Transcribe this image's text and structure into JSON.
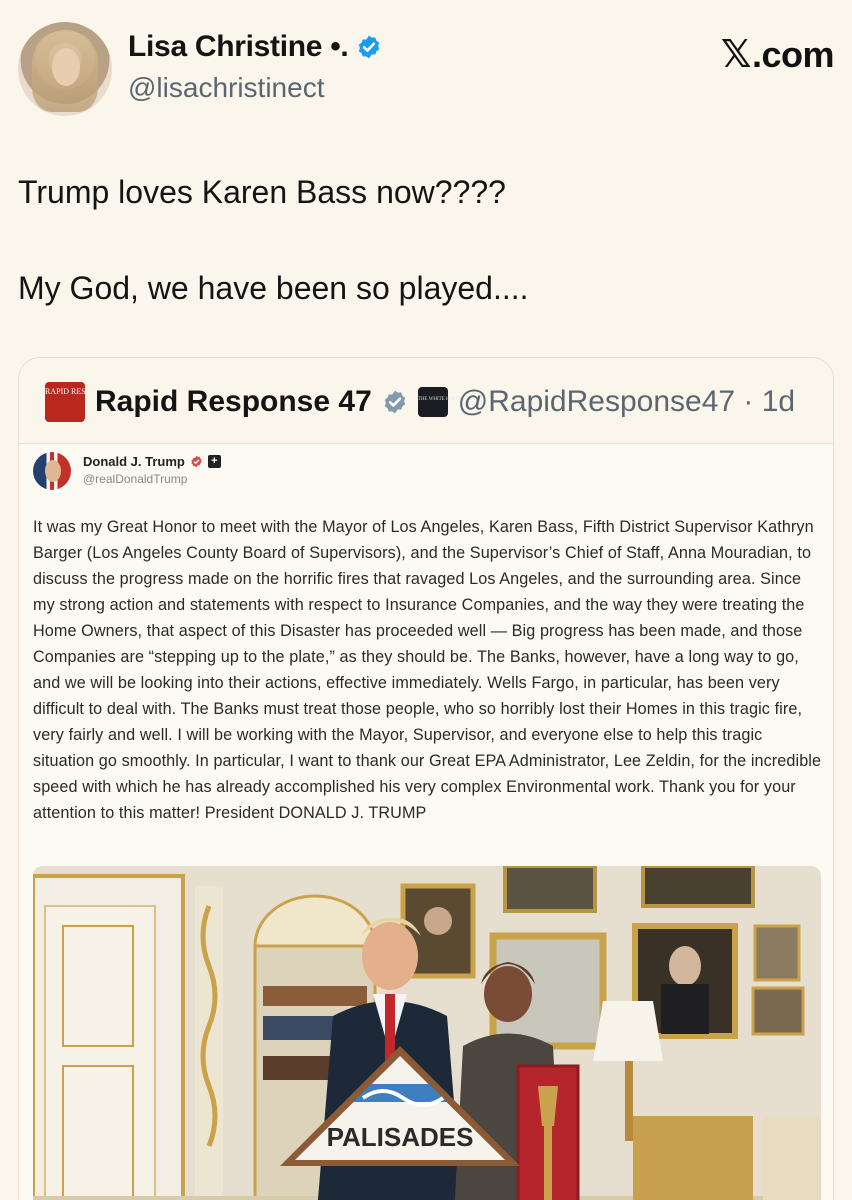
{
  "site_logo": {
    "x_glyph": "𝕏",
    "text": ".com"
  },
  "author": {
    "display_name": "Lisa Christine •.",
    "handle": "@lisachristinect",
    "avatar_icon": "user-avatar"
  },
  "tweet": {
    "line1": "Trump loves Karen Bass now????",
    "line2": "My God, we have been so played...."
  },
  "quote": {
    "logo_text": "RAPID RESPONSE",
    "display_name": "Rapid Response 47",
    "wh_badge_text": "THE WHITE HOUSE",
    "handle_time": "@RapidResponse47 · 1d",
    "embedded": {
      "name": "Donald J. Trump",
      "handle": "@realDonaldTrump",
      "body": "It was my Great Honor to meet with the Mayor of Los Angeles, Karen Bass, Fifth District Supervisor Kathryn Barger (Los Angeles County Board of Supervisors), and the Supervisor’s Chief of Staff, Anna Mouradian, to discuss the progress made on the horrific fires that ravaged Los Angeles, and the surrounding area. Since my strong action and statements with respect to Insurance Companies, and the way they were treating the Home Owners, that aspect of this Disaster has proceeded well — Big progress has been made, and those Companies are “stepping up to the plate,” as they should be. The Banks, however, have a long way to go, and we will be looking into their actions, effective immediately. Wells Fargo, in particular, has been very difficult to deal with. The Banks must treat those people, who so horribly lost their Homes in this tragic fire, very fairly and well. I will be working with the Mayor, Supervisor, and everyone else to help this tragic situation go smoothly. In particular, I want to thank our Great EPA Administrator, Lee Zeldin, for the incredible speed with which he has already accomplished his very complex Environmental work. Thank you for your attention to this matter! President DONALD J. TRUMP",
      "sign_text": "PALISADES"
    }
  },
  "colors": {
    "verified_blue": "#1d9bf0",
    "brand_red": "#b8281f",
    "background": "#fbf6ec"
  }
}
